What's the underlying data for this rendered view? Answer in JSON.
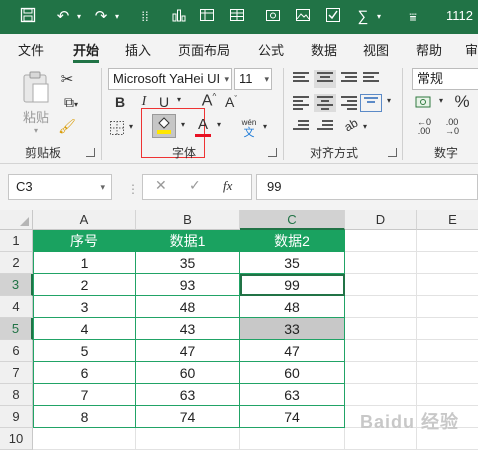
{
  "qat": {
    "title": "1112",
    "icons": [
      "save-icon",
      "undo-icon",
      "redo-icon",
      "format-painter-icon",
      "chart-icon",
      "table-icon",
      "screenshot-icon",
      "image-icon",
      "checkbox-icon",
      "sigma-icon",
      "more-icon"
    ]
  },
  "tabs": [
    "文件",
    "开始",
    "插入",
    "页面布局",
    "公式",
    "数据",
    "视图",
    "帮助",
    "审"
  ],
  "active_tab": "开始",
  "ribbon": {
    "clipboard": {
      "paste_label": "粘贴",
      "group_label": "剪贴板"
    },
    "font": {
      "font_name": "Microsoft YaHei UI",
      "font_size": "11",
      "bold": "B",
      "italic": "I",
      "underline": "U",
      "grow": "A",
      "shrink": "A",
      "font_color": "A",
      "phonetic_top": "wén",
      "phonetic_bottom": "文",
      "group_label": "字体"
    },
    "alignment": {
      "group_label": "对齐方式"
    },
    "number": {
      "format": "常规",
      "percent": "%",
      "group_label": "数字"
    }
  },
  "formula_bar": {
    "name_box": "C3",
    "fx": "fx",
    "value": "99"
  },
  "columns": [
    "A",
    "B",
    "C",
    "D",
    "E"
  ],
  "selected_column": "C",
  "rows": [
    "1",
    "2",
    "3",
    "4",
    "5",
    "6",
    "7",
    "8",
    "9",
    "10"
  ],
  "selected_rows": [
    "3",
    "5"
  ],
  "table": {
    "headers": [
      "序号",
      "数据1",
      "数据2"
    ],
    "rows": [
      [
        "1",
        "35",
        "35"
      ],
      [
        "2",
        "93",
        "99"
      ],
      [
        "3",
        "48",
        "48"
      ],
      [
        "4",
        "43",
        "33"
      ],
      [
        "5",
        "47",
        "47"
      ],
      [
        "6",
        "60",
        "60"
      ],
      [
        "7",
        "63",
        "63"
      ],
      [
        "8",
        "74",
        "74"
      ]
    ]
  },
  "colors": {
    "excel_green": "#217346",
    "header_fill": "#1aa260",
    "gray_fill": "#c8c8c8",
    "highlight_box": "#e33333",
    "fill_yellow": "#ffe600",
    "font_red": "#e81123"
  },
  "watermark": "Baidu 经验"
}
